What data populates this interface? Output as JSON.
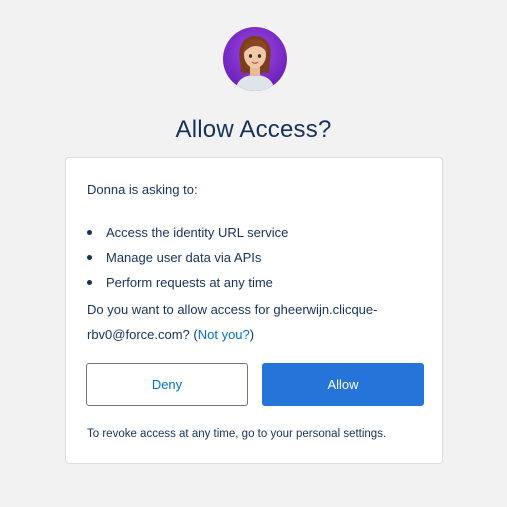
{
  "avatar": {
    "icon": "user-avatar-icon",
    "bg_color": "#8e3ad8"
  },
  "header": {
    "title": "Allow Access?"
  },
  "card": {
    "intro": "Donna is asking to:",
    "scopes": [
      "Access the identity URL service",
      "Manage user data via APIs",
      "Perform requests at any time"
    ],
    "question_text": "Do you want to allow access for gheerwijn.clicque-rbv0@force.com? (",
    "not_you_link": "Not you?",
    "question_close": ")",
    "deny_label": "Deny",
    "allow_label": "Allow",
    "revoke_text": "To revoke access at any time, go to your personal settings."
  },
  "colors": {
    "page_bg": "#f3f2f2",
    "text": "#16325c",
    "link": "#0070d2",
    "allow_bg": "#2574d9"
  }
}
